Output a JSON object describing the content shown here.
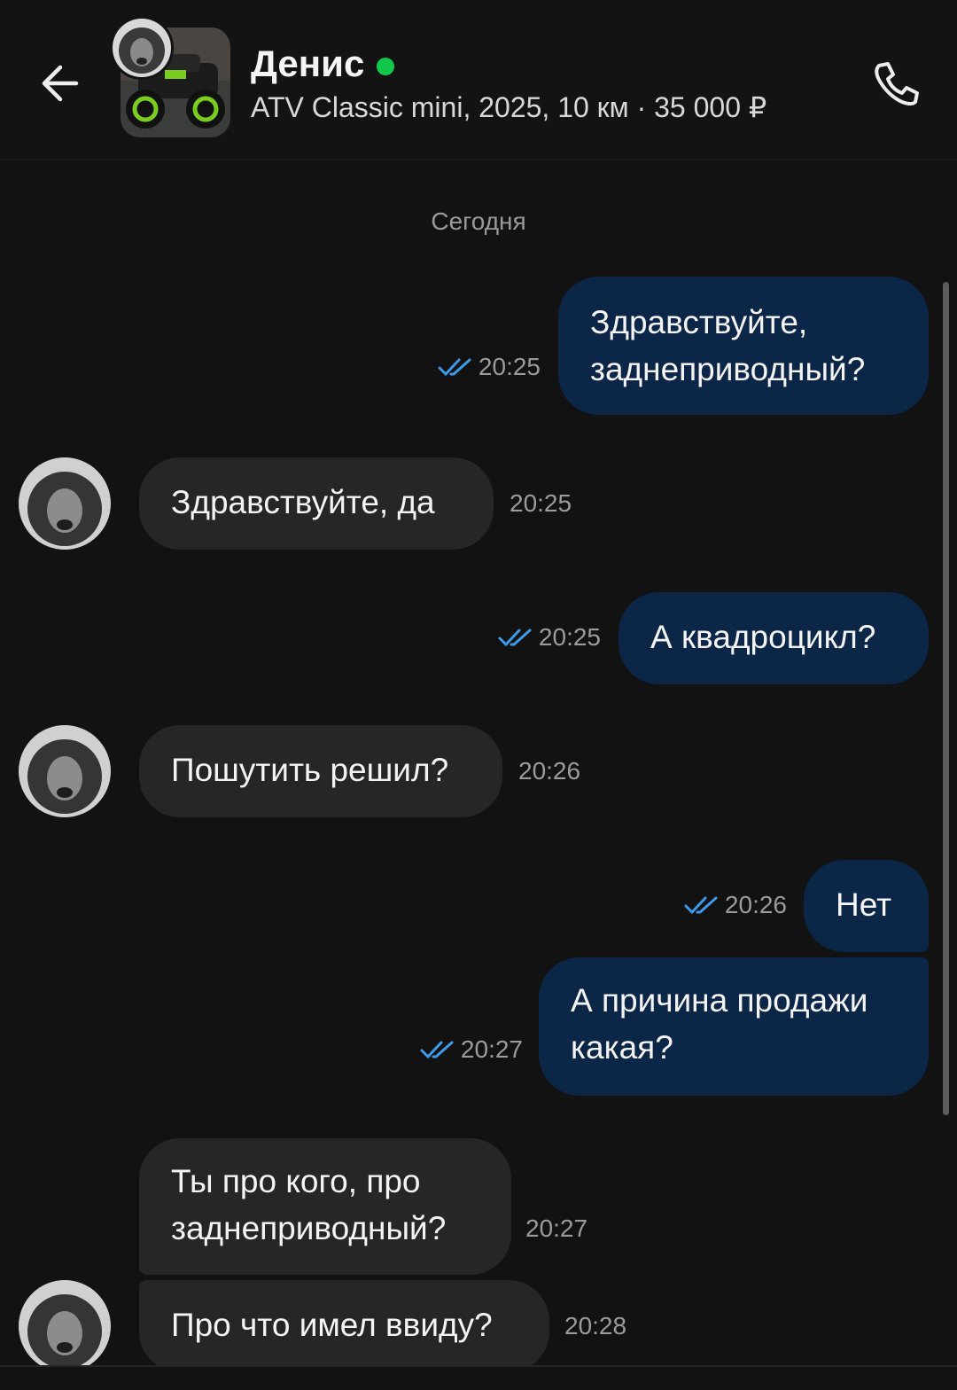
{
  "header": {
    "name": "Денис",
    "listing": "ATV Classic mini, 2025, 10 км · 35 000 ₽",
    "accent_online": "#12c84a",
    "icons": {
      "back": "arrow-left-icon",
      "phone": "phone-icon"
    }
  },
  "date_separator": "Сегодня",
  "colors": {
    "background": "#121212",
    "outgoing_bubble": "#0c2647",
    "incoming_bubble": "#262626",
    "read_check": "#3d9be9"
  },
  "messages": [
    {
      "direction": "out",
      "text": "Здравствуйте,\nзаднеприводный?",
      "time": "20:25",
      "read": true
    },
    {
      "direction": "in",
      "text": "Здравствуйте, да",
      "time": "20:25"
    },
    {
      "direction": "out",
      "text": "А квадроцикл?",
      "time": "20:25",
      "read": true
    },
    {
      "direction": "in",
      "text": "Пошутить решил?",
      "time": "20:26"
    },
    {
      "direction": "out",
      "text": "Нет",
      "time": "20:26",
      "read": true
    },
    {
      "direction": "out",
      "text": "А причина продажи\nкакая?",
      "time": "20:27",
      "read": true
    },
    {
      "direction": "in",
      "text": "Ты про кого, про\nзаднеприводный?",
      "time": "20:27"
    },
    {
      "direction": "in",
      "text": "Про что имел ввиду?",
      "time": "20:28"
    }
  ]
}
